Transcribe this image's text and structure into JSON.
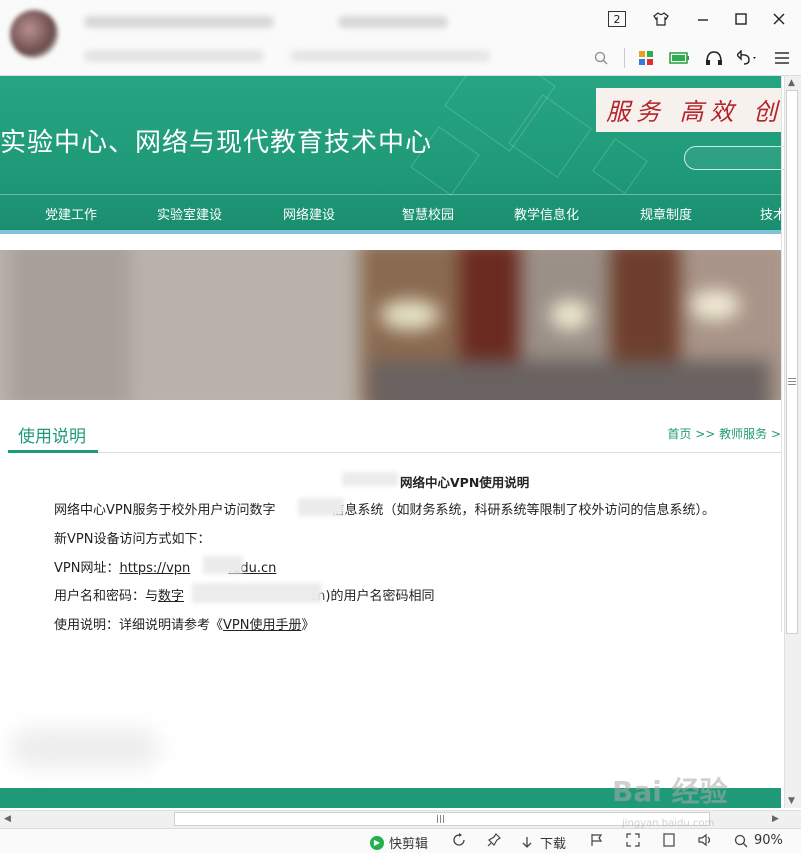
{
  "browser": {
    "tab_count": "2",
    "zoom": "90%",
    "status_items": {
      "quick_clip": "快剪辑",
      "download": "下载"
    }
  },
  "site": {
    "title": "实验中心、网络与现代教育技术中心",
    "slogan": "服务 高效 创新",
    "nav": [
      "党建工作",
      "实验室建设",
      "网络建设",
      "智慧校园",
      "教学信息化",
      "规章制度",
      "技术"
    ],
    "theme_color": "#1f9a79"
  },
  "content": {
    "section_title": "使用说明",
    "breadcrumb": "首页 >> 教师服务 >",
    "article_title": "网络中心VPN使用说明",
    "paragraphs": {
      "p1_a": "网络中心VPN服务于校外用户访问数字",
      "p1_b": "信息系统（如财务系统，科研系统等限制了校外访问的信息系统）。",
      "p2": "新VPN设备访问方式如下：",
      "p3_label": "VPN网址：",
      "p3_link_a": "https://vpn",
      "p3_link_b": ".edu.cn",
      "p4_a": "用户名和密码：与",
      "p4_b": "数字",
      "p4_c": "cn)的用户名密码相同",
      "p5_a": "使用说明：详细说明请参考《",
      "p5_link": "VPN使用手册",
      "p5_b": "》"
    }
  },
  "watermark": {
    "main": "Bai 经验",
    "sub": "jingyan.baidu.com"
  }
}
